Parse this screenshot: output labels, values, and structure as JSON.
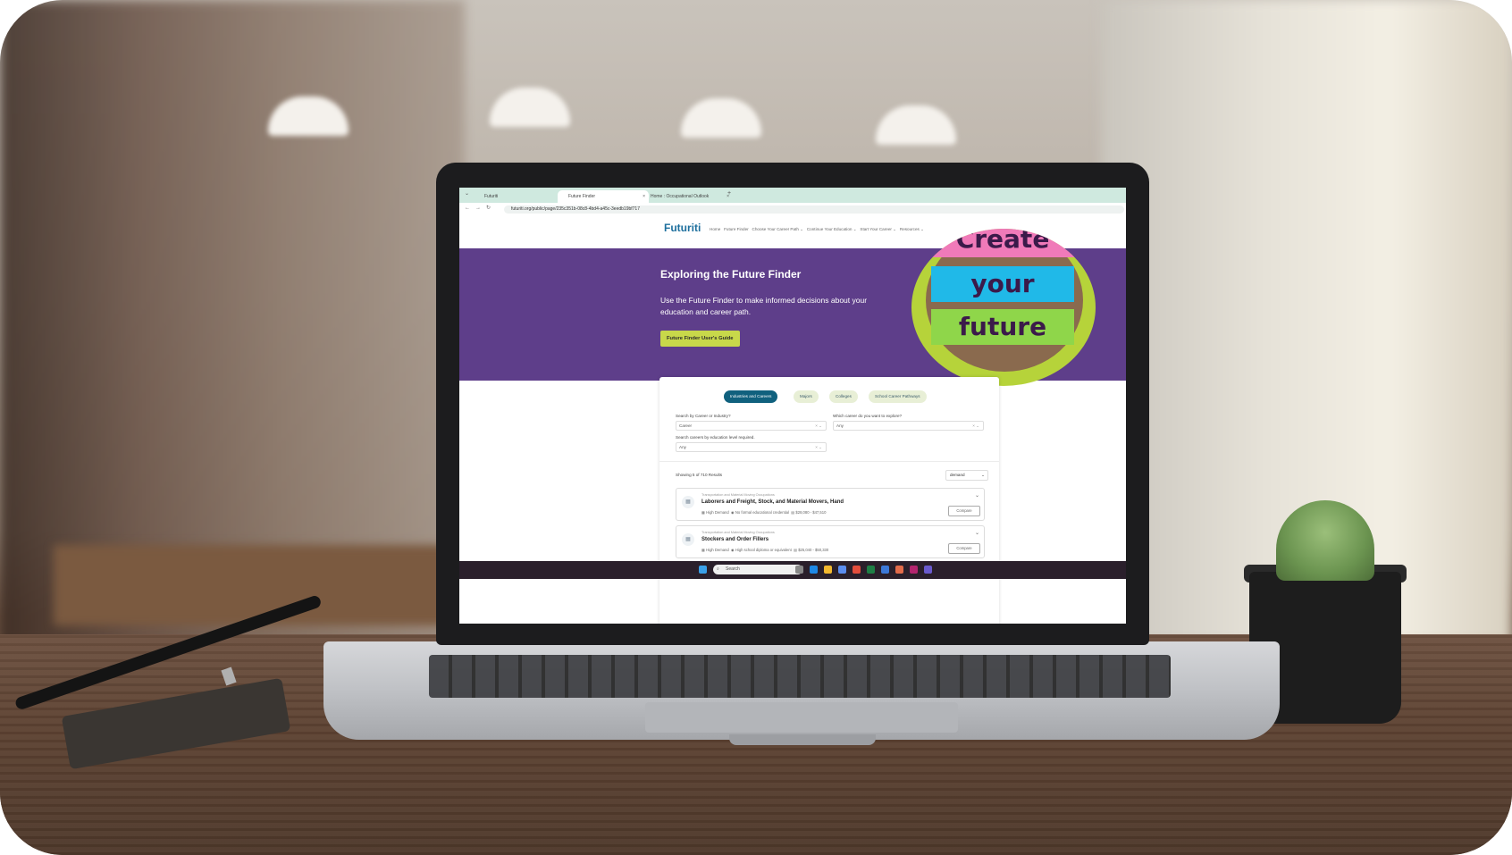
{
  "browser": {
    "tabs": [
      {
        "label": "Futuriti",
        "active": false
      },
      {
        "label": "Future Finder",
        "active": true
      },
      {
        "label": "Home : Occupational Outlook",
        "active": false
      }
    ],
    "new_tab": "+",
    "url": "futuriti.org/public/page/235c351b-08c8-4bd4-a45c-3eedb19bf717"
  },
  "site": {
    "logo": "Futuriti",
    "nav": [
      "Home",
      "Future Finder",
      "Choose Your Career Path ⌄",
      "Continue Your Education ⌄",
      "Start Your Career ⌄",
      "Resources ⌄"
    ]
  },
  "hero": {
    "title": "Exploring the Future Finder",
    "subtitle": "Use the Future Finder to make informed decisions about your education and career path.",
    "button": "Future Finder User's Guide",
    "badge_words": [
      "Create",
      "your",
      "future"
    ]
  },
  "finder": {
    "tabs": [
      "Industries and Careers",
      "Majors",
      "Colleges",
      "School Career Pathways"
    ],
    "fields": {
      "search_label": "Search by Career or Industry?",
      "search_value": "Career",
      "explore_label": "Which career do you want to explore?",
      "explore_value": "Any",
      "education_label": "Search careers by education level required.",
      "education_value": "Any"
    },
    "results_count": "Showing 5 of 710 Results",
    "sort_value": "demand",
    "results": [
      {
        "category": "Transportation and Material Moving Occupations",
        "title": "Laborers and Freight, Stock, and Material Movers, Hand",
        "demand": "High Demand",
        "education": "No formal educational credential",
        "salary": "$28,080 - $47,510",
        "compare": "Compare"
      },
      {
        "category": "Transportation and Material Moving Occupations",
        "title": "Stockers and Order Fillers",
        "demand": "High Demand",
        "education": "High school diploma or equivalent",
        "salary": "$25,040 - $50,330",
        "compare": "Compare"
      }
    ]
  },
  "taskbar": {
    "search_placeholder": "Search"
  },
  "colors": {
    "hero_bg": "#5e3e8a",
    "accent_button": "#c8d84a",
    "active_pill": "#10617e",
    "logo_blue": "#1d6f9d"
  }
}
